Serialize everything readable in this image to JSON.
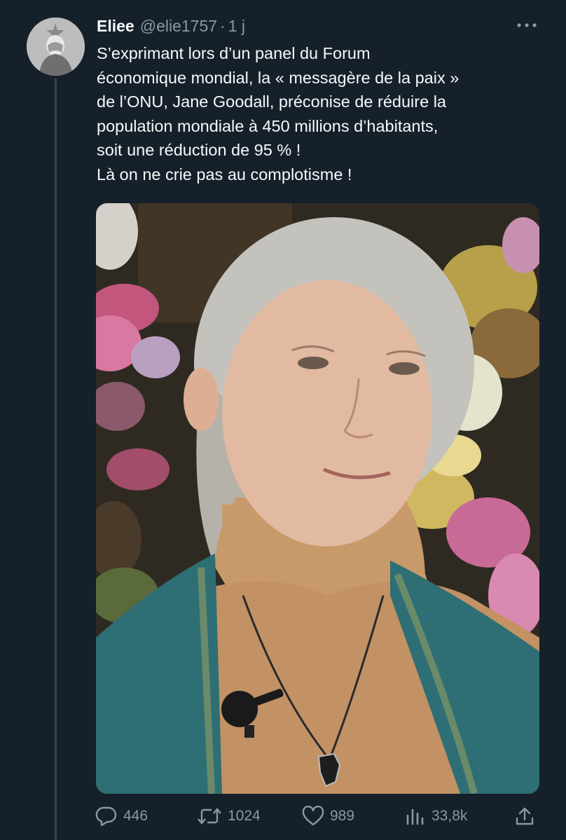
{
  "tweet": {
    "author_name": "Eliee",
    "handle": "@elie1757",
    "separator": "·",
    "time": "1 j",
    "text_lines": [
      "S’exprimant lors d’un panel du Forum",
      "économique mondial, la « messagère de la paix »",
      "de l’ONU, Jane Goodall, préconise de réduire la",
      "population mondiale à 450 millions d’habitants,",
      "soit une réduction de 95 % !",
      "Là on ne crie pas au complotisme !"
    ]
  },
  "actions": {
    "replies": "446",
    "retweets": "1024",
    "likes": "989",
    "views": "33,8k"
  },
  "icons": {
    "more": "more-horizontal-icon",
    "reply": "reply-bubble-icon",
    "retweet": "retweet-icon",
    "like": "heart-icon",
    "views": "views-bar-chart-icon",
    "share": "share-upload-icon"
  },
  "colors": {
    "background": "#15202b",
    "text": "#f7f9f9",
    "secondary": "#8b98a5",
    "thread_line": "#38444d"
  }
}
